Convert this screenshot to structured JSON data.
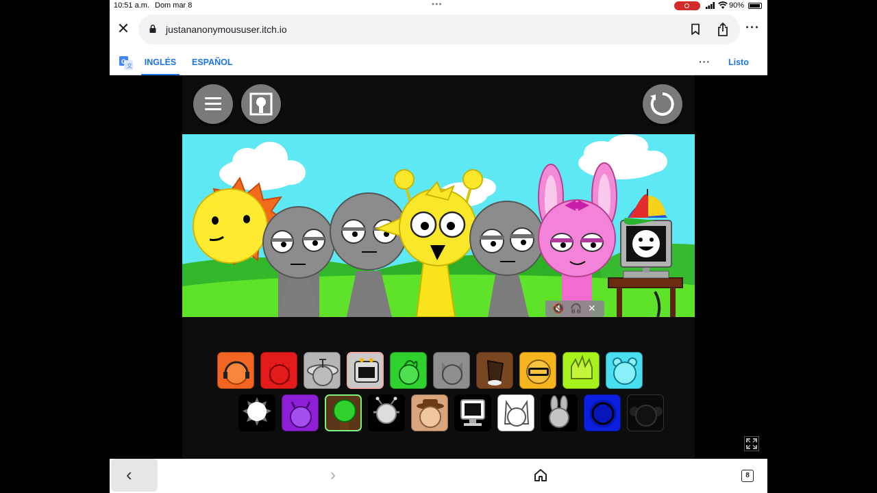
{
  "status_bar": {
    "time": "10:51 a.m.",
    "date": "Dom mar 8",
    "battery": "90%"
  },
  "browser": {
    "url": "justananonymoususer.itch.io",
    "translate": {
      "tab_source": "INGLÉS",
      "tab_target": "ESPAÑOL",
      "done_label": "Listo"
    },
    "tab_count": "8"
  },
  "game": {
    "tray_row1": [
      {
        "name": "orange-headphones",
        "color": "#f26522"
      },
      {
        "name": "red-spiky",
        "color": "#e31b1b"
      },
      {
        "name": "gray-antenna",
        "color": "#b5b5b5"
      },
      {
        "name": "gray-screen",
        "color": "#c9c9c9"
      },
      {
        "name": "green-vine",
        "color": "#2ed12e"
      },
      {
        "name": "gray-cat",
        "color": "#8e8e8e"
      },
      {
        "name": "brown-bucket",
        "color": "#7a4622"
      },
      {
        "name": "yellow-visor",
        "color": "#f7b51d"
      },
      {
        "name": "lime-spiky",
        "color": "#a6f21a"
      },
      {
        "name": "cyan-bear",
        "color": "#49dff0"
      }
    ],
    "tray_row2": [
      {
        "name": "white-sun",
        "color": "#000000"
      },
      {
        "name": "purple-horns",
        "color": "#8d1fd6"
      },
      {
        "name": "brown-tree",
        "color": "#5a3518"
      },
      {
        "name": "white-bug",
        "color": "#000000"
      },
      {
        "name": "tan-hat",
        "color": "#d9a57c"
      },
      {
        "name": "white-computer",
        "color": "#000000"
      },
      {
        "name": "white-cat",
        "color": "#ffffff"
      },
      {
        "name": "gray-bunny",
        "color": "#000000"
      },
      {
        "name": "blue-ring",
        "color": "#0a1fe0"
      },
      {
        "name": "black-pigtails",
        "color": "#0a0a0a"
      }
    ]
  }
}
